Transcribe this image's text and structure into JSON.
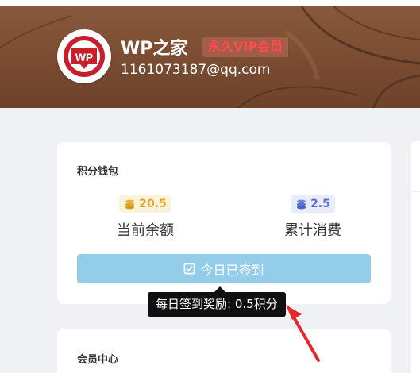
{
  "profile": {
    "site_name": "WP之家",
    "vip_badge": "永久VIP会员",
    "email": "1161073187@qq.com",
    "logo_text": "WP"
  },
  "wallet": {
    "title": "积分钱包",
    "balance_value": "20.5",
    "balance_label": "当前余额",
    "spent_value": "2.5",
    "spent_label": "累计消费",
    "checkin_label": "今日已签到",
    "tooltip": "每日签到奖励: 0.5积分"
  },
  "member": {
    "title": "会员中心"
  },
  "colors": {
    "banner": "#7a4c31",
    "vip": "#ff4b4b",
    "balance_accent": "#e0a52a",
    "spent_accent": "#5a6fd6",
    "checkin_button": "#94cdea",
    "logo_red": "#c8202a",
    "annotation_arrow": "#e8262b"
  },
  "icons": {
    "logo": "wp-logo-icon",
    "balance": "coins-icon",
    "spent": "coin-stack-icon",
    "checkin": "checkbox-icon",
    "annotation": "red-arrow-icon"
  }
}
